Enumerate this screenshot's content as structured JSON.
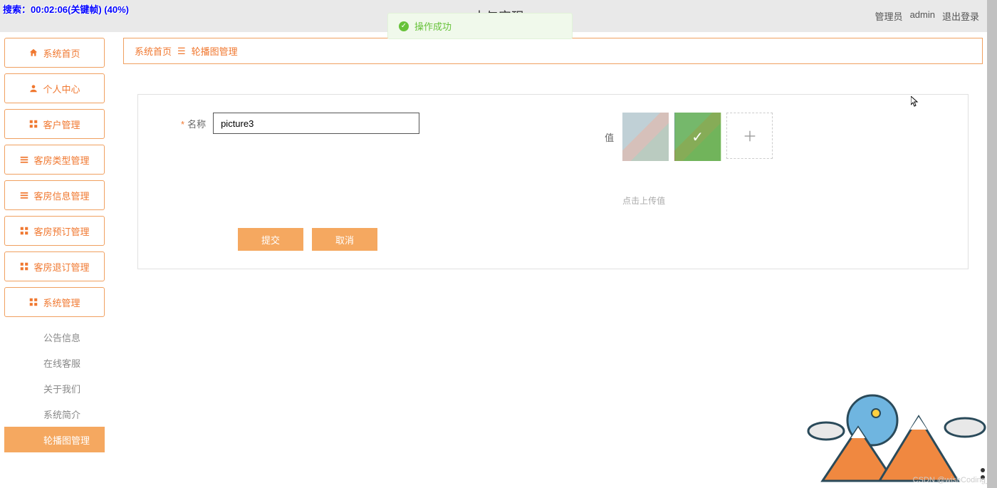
{
  "overlay": {
    "text": "搜索：00:02:06(关键帧) (40%)"
  },
  "header": {
    "title_fragment": "十与实现",
    "role_label": "管理员",
    "username": "admin",
    "logout": "退出登录"
  },
  "toast": {
    "message": "操作成功"
  },
  "sidebar": {
    "items": [
      {
        "label": "系统首页",
        "icon": "home"
      },
      {
        "label": "个人中心",
        "icon": "user"
      },
      {
        "label": "客户管理",
        "icon": "grid"
      },
      {
        "label": "客房类型管理",
        "icon": "list"
      },
      {
        "label": "客房信息管理",
        "icon": "list"
      },
      {
        "label": "客房预订管理",
        "icon": "grid"
      },
      {
        "label": "客房退订管理",
        "icon": "grid"
      },
      {
        "label": "系统管理",
        "icon": "grid"
      }
    ],
    "sub_items": [
      {
        "label": "公告信息",
        "active": false
      },
      {
        "label": "在线客服",
        "active": false
      },
      {
        "label": "关于我们",
        "active": false
      },
      {
        "label": "系统简介",
        "active": false
      },
      {
        "label": "轮播图管理",
        "active": true
      }
    ]
  },
  "breadcrumb": {
    "root": "系统首页",
    "current": "轮播图管理"
  },
  "form": {
    "name_label": "名称",
    "name_value": "picture3",
    "value_label": "值",
    "upload_hint": "点击上传值",
    "submit": "提交",
    "cancel": "取消"
  },
  "watermark": "CSDN @wishCoding_"
}
